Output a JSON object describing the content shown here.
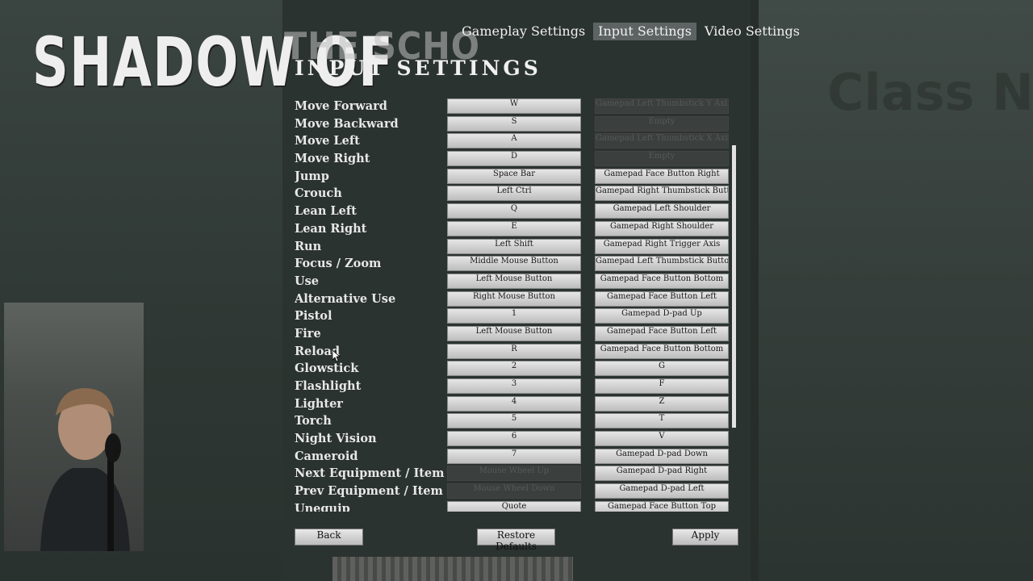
{
  "logo": {
    "text": "SHADOW OF",
    "faded_text": "THE SCHO"
  },
  "background_watermark": "Class No",
  "tabs": [
    {
      "label": "Gameplay Settings",
      "active": false
    },
    {
      "label": "Input Settings",
      "active": true
    },
    {
      "label": "Video Settings",
      "active": false
    }
  ],
  "page_title": "INPUT SETTINGS",
  "bindings": [
    {
      "action": "Move Forward",
      "key": "W",
      "gamepad": "Gamepad Left Thumbstick Y Axis",
      "gamepad_disabled": true
    },
    {
      "action": "Move Backward",
      "key": "S",
      "gamepad": "Empty",
      "gamepad_disabled": true
    },
    {
      "action": "Move Left",
      "key": "A",
      "gamepad": "Gamepad Left Thumbstick X Axis",
      "gamepad_disabled": true
    },
    {
      "action": "Move Right",
      "key": "D",
      "gamepad": "Empty",
      "gamepad_disabled": true
    },
    {
      "action": "Jump",
      "key": "Space Bar",
      "gamepad": "Gamepad Face Button Right"
    },
    {
      "action": "Crouch",
      "key": "Left Ctrl",
      "gamepad": "Gamepad Right Thumbstick Button"
    },
    {
      "action": "Lean Left",
      "key": "Q",
      "gamepad": "Gamepad Left Shoulder"
    },
    {
      "action": "Lean Right",
      "key": "E",
      "gamepad": "Gamepad Right Shoulder"
    },
    {
      "action": "Run",
      "key": "Left Shift",
      "gamepad": "Gamepad Right Trigger Axis"
    },
    {
      "action": "Focus / Zoom",
      "key": "Middle Mouse Button",
      "gamepad": "Gamepad Left Thumbstick Button"
    },
    {
      "action": "Use",
      "key": "Left Mouse Button",
      "gamepad": "Gamepad Face Button Bottom"
    },
    {
      "action": "Alternative Use",
      "key": "Right Mouse Button",
      "gamepad": "Gamepad Face Button Left"
    },
    {
      "action": "Pistol",
      "key": "1",
      "gamepad": "Gamepad D-pad Up"
    },
    {
      "action": "Fire",
      "key": "Left Mouse Button",
      "gamepad": "Gamepad Face Button Left"
    },
    {
      "action": "Reload",
      "key": "R",
      "gamepad": "Gamepad Face Button Bottom"
    },
    {
      "action": "Glowstick",
      "key": "2",
      "gamepad": "G"
    },
    {
      "action": "Flashlight",
      "key": "3",
      "gamepad": "F"
    },
    {
      "action": "Lighter",
      "key": "4",
      "gamepad": "Z"
    },
    {
      "action": "Torch",
      "key": "5",
      "gamepad": "T"
    },
    {
      "action": "Night Vision",
      "key": "6",
      "gamepad": "V"
    },
    {
      "action": "Cameroid",
      "key": "7",
      "gamepad": "Gamepad D-pad Down"
    },
    {
      "action": "Next Equipment / Item",
      "key": "Mouse Wheel Up",
      "key_disabled": true,
      "gamepad": "Gamepad D-pad Right"
    },
    {
      "action": "Prev Equipment / Item",
      "key": "Mouse Wheel Down",
      "key_disabled": true,
      "gamepad": "Gamepad D-pad Left"
    },
    {
      "action": "Unequip",
      "key": "Quote",
      "gamepad": "Gamepad Face Button Top"
    }
  ],
  "buttons": {
    "back": "Back",
    "restore": "Restore Defaults",
    "apply": "Apply"
  },
  "colors": {
    "panel": "#2b3331",
    "tab_active": "#5c6362",
    "button_light": "#e6e6e6",
    "button_dark": "#bdbdbd"
  }
}
